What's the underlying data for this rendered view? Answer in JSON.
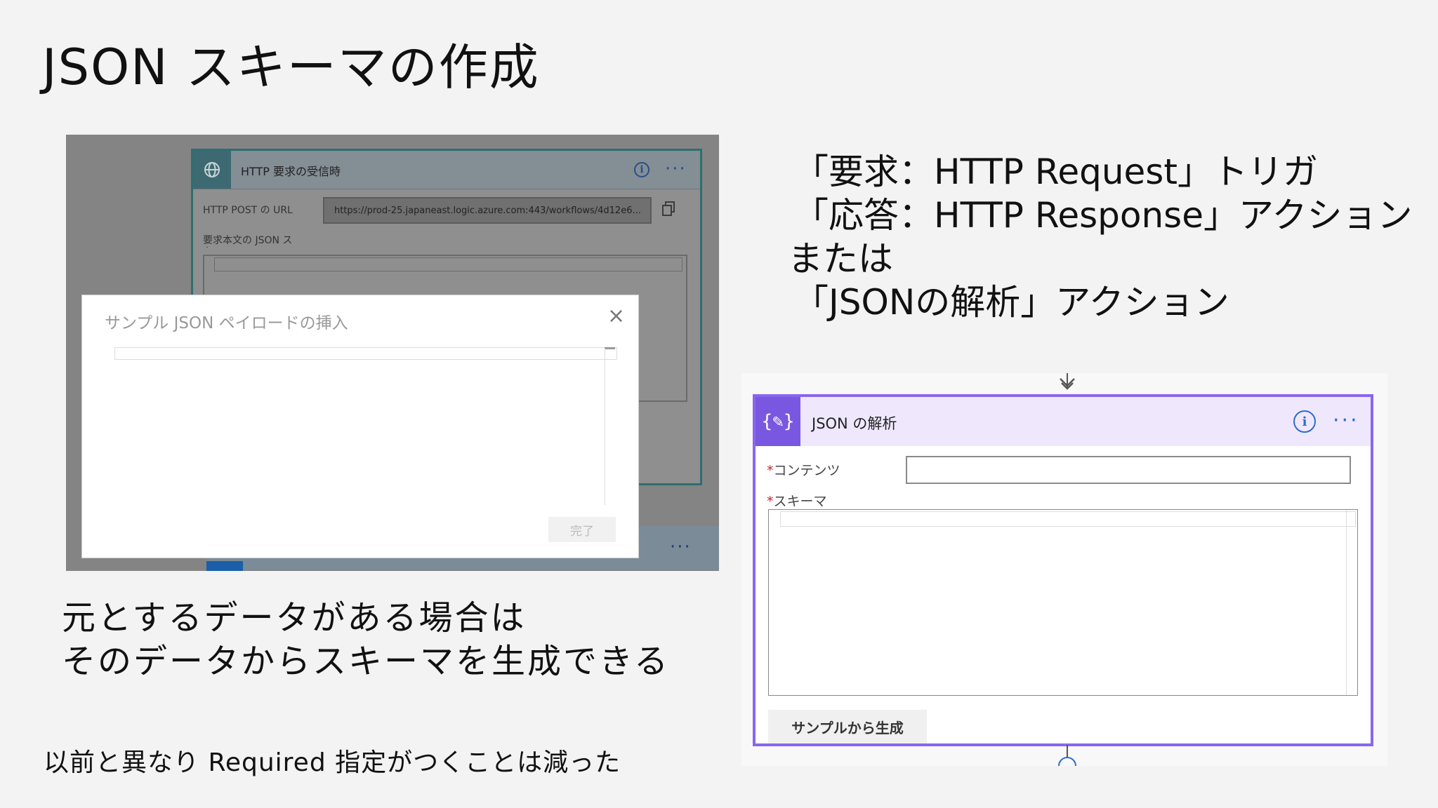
{
  "slide": {
    "title": "JSON スキーマの作成",
    "right_lines": [
      "「要求：HTTP Request」トリガ",
      "「応答：HTTP Response」アクション",
      "または",
      "「JSONの解析」アクション"
    ],
    "caption_lines": [
      "元とするデータがある場合は",
      "そのデータからスキーマを生成できる"
    ],
    "footer_note": "以前と異なり Required 指定がつくことは減った"
  },
  "http_trigger": {
    "title": "HTTP 要求の受信時",
    "url_label": "HTTP POST の URL",
    "url_value": "https://prod-25.japaneast.logic.azure.com:443/workflows/4d12e6...",
    "schema_label": "要求本文の JSON スキーマ",
    "icon": "globe-icon",
    "more": "···"
  },
  "sample_modal": {
    "title": "サンプル JSON ペイロードの挿入",
    "close": "×",
    "done_label": "完了"
  },
  "parse_json": {
    "title": "JSON の解析",
    "icon_glyph": "{✎}",
    "info": "i",
    "more": "···",
    "required_mark": "*",
    "content_label": "コンテンツ",
    "schema_label": "スキーマ",
    "generate_button": "サンプルから生成",
    "colors": {
      "accent": "#8a66f0",
      "header_bg": "#efe8fd",
      "icon_bg": "#7a57e0",
      "link": "#2b6cd1"
    }
  }
}
